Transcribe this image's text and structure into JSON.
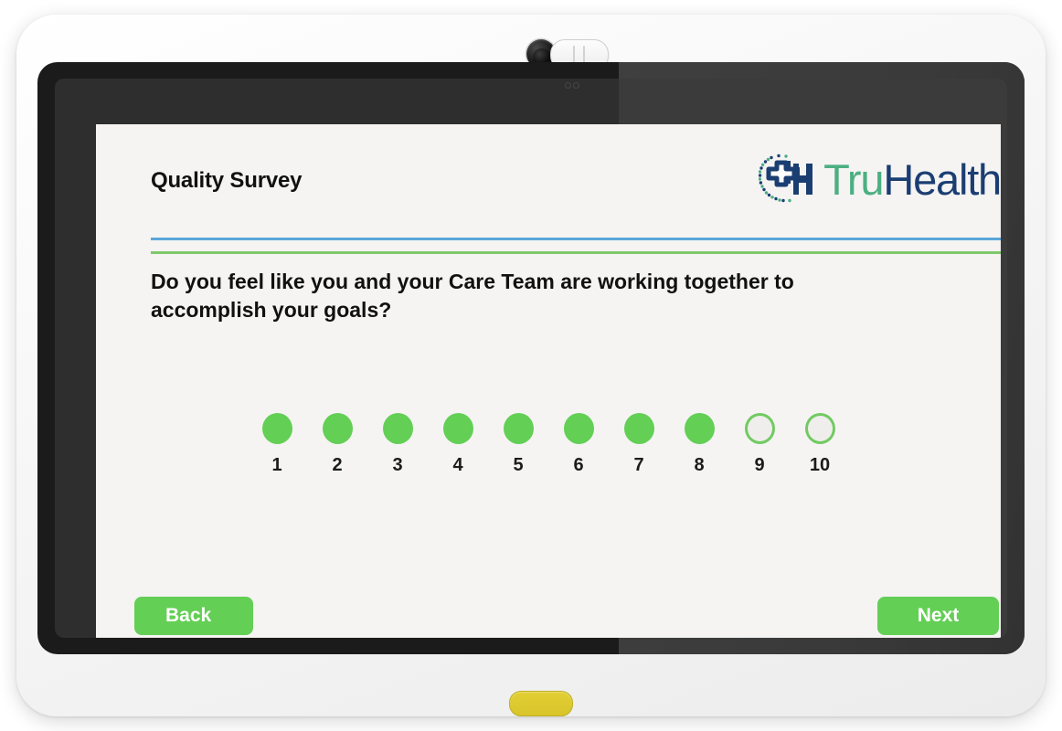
{
  "device": {
    "type": "tablet-kiosk",
    "camera_icon": "camera-lens",
    "privacy_shutter_icon": "privacy-slider",
    "home_button_icon": "home-button",
    "home_button_color": "#d8c52b"
  },
  "brand": {
    "logo_icon": "truhealth-cross-logo",
    "name_part1": "Tru",
    "name_part2": "Health",
    "color_part1": "#4caf82",
    "color_part2": "#1b3e72"
  },
  "header": {
    "title": "Quality Survey",
    "divider_blue_color": "#5aa7da",
    "divider_green_color": "#7fc96a"
  },
  "survey": {
    "question": "Do you feel like you and your Care Team are working together to accomplish your goals?",
    "scale": {
      "min": 1,
      "max": 10,
      "selected_through": 8,
      "filled_color": "#63cf55",
      "empty_border_color": "#72ca62",
      "options": [
        {
          "label": "1",
          "filled": true
        },
        {
          "label": "2",
          "filled": true
        },
        {
          "label": "3",
          "filled": true
        },
        {
          "label": "4",
          "filled": true
        },
        {
          "label": "5",
          "filled": true
        },
        {
          "label": "6",
          "filled": true
        },
        {
          "label": "7",
          "filled": true
        },
        {
          "label": "8",
          "filled": true
        },
        {
          "label": "9",
          "filled": false
        },
        {
          "label": "10",
          "filled": false
        }
      ]
    }
  },
  "navigation": {
    "back_label": "Back",
    "next_label": "Next",
    "button_color": "#63cf55"
  },
  "footer": {
    "bar_green_color": "#63cf55",
    "bar_blue_color": "#55aee0"
  }
}
